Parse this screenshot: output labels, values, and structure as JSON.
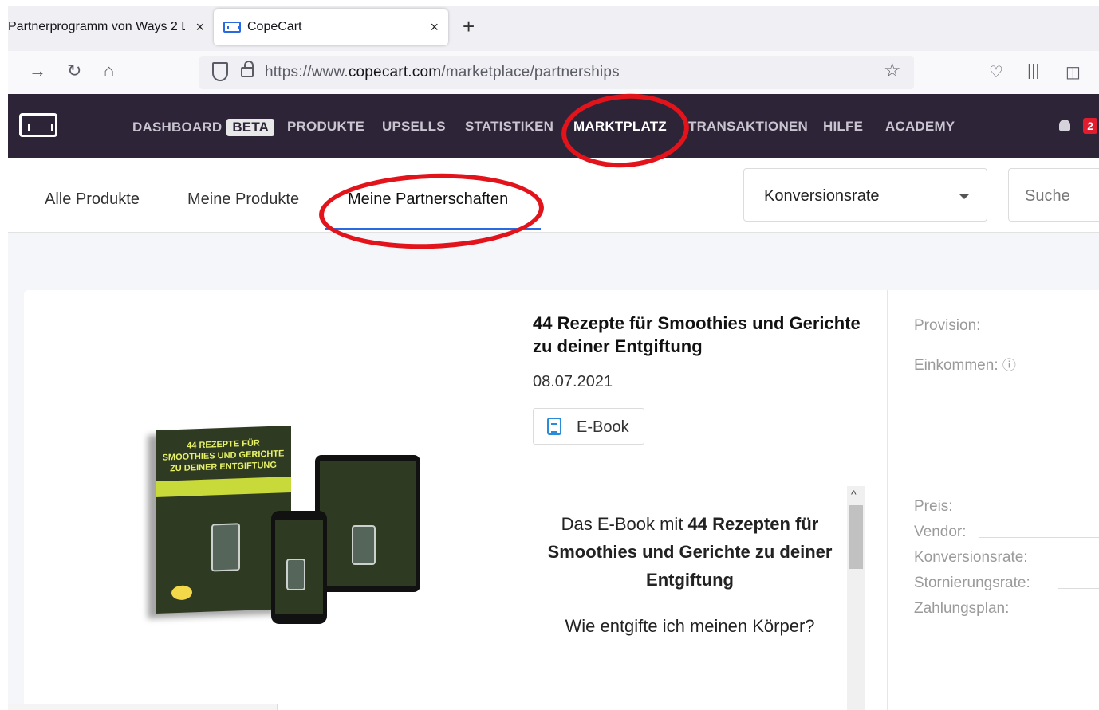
{
  "browser": {
    "tabs": [
      {
        "title": "Partnerprogramm von Ways 2 L",
        "active": false
      },
      {
        "title": "CopeCart",
        "active": true
      }
    ],
    "close_glyph": "×",
    "new_tab_glyph": "+",
    "url_prefix": "https://www.",
    "url_domain": "copecart.com",
    "url_path": "/marketplace/partnerships",
    "nav_icons": [
      "forward-icon",
      "reload-icon",
      "home-icon",
      "shield-icon",
      "lock-icon",
      "bookmark-star-icon",
      "pocket-icon",
      "library-icon",
      "sidebar-icon"
    ]
  },
  "app": {
    "menu": [
      {
        "label": "DASHBOARD",
        "badge": "BETA"
      },
      {
        "label": "PRODUKTE"
      },
      {
        "label": "UPSELLS"
      },
      {
        "label": "STATISTIKEN"
      },
      {
        "label": "MARKTPLATZ",
        "active": true
      },
      {
        "label": "TRANSAKTIONEN"
      },
      {
        "label": "HILFE"
      },
      {
        "label": "ACADEMY"
      }
    ],
    "notification_count": "2"
  },
  "subnav": {
    "tabs": [
      "Alle Produkte",
      "Meine Produkte",
      "Meine Partnerschaften"
    ],
    "active_tab": "Meine Partnerschaften",
    "sort_value": "Konversionsrate",
    "search_placeholder": "Suche"
  },
  "product": {
    "title": "44 Rezepte für Smoothies und Gerichte zu deiner Entgiftung",
    "date": "08.07.2021",
    "type": "E-Book",
    "cover_text": "44 REZEPTE FÜR SMOOTHIES UND GERICHTE ZU DEINER ENTGIFTUNG",
    "description_intro": "Das E-Book mit ",
    "description_bold": "44 Rezepten für Smoothies und Gerichte zu deiner Entgiftung",
    "description_question": "Wie entgifte ich meinen Körper?",
    "scroll_up_glyph": "^"
  },
  "details": {
    "provision": "Provision:",
    "einkommen": "Einkommen:",
    "info_icon": "ⓘ",
    "rows": [
      "Preis:",
      "Vendor:",
      "Konversionsrate:",
      "Stornierungsrate:",
      "Zahlungsplan:"
    ]
  },
  "colors": {
    "header_bg": "#2d2438",
    "accent_blue": "#2a6ae0",
    "annotation_red": "#e2131b",
    "notification_red": "#e01c2e"
  }
}
